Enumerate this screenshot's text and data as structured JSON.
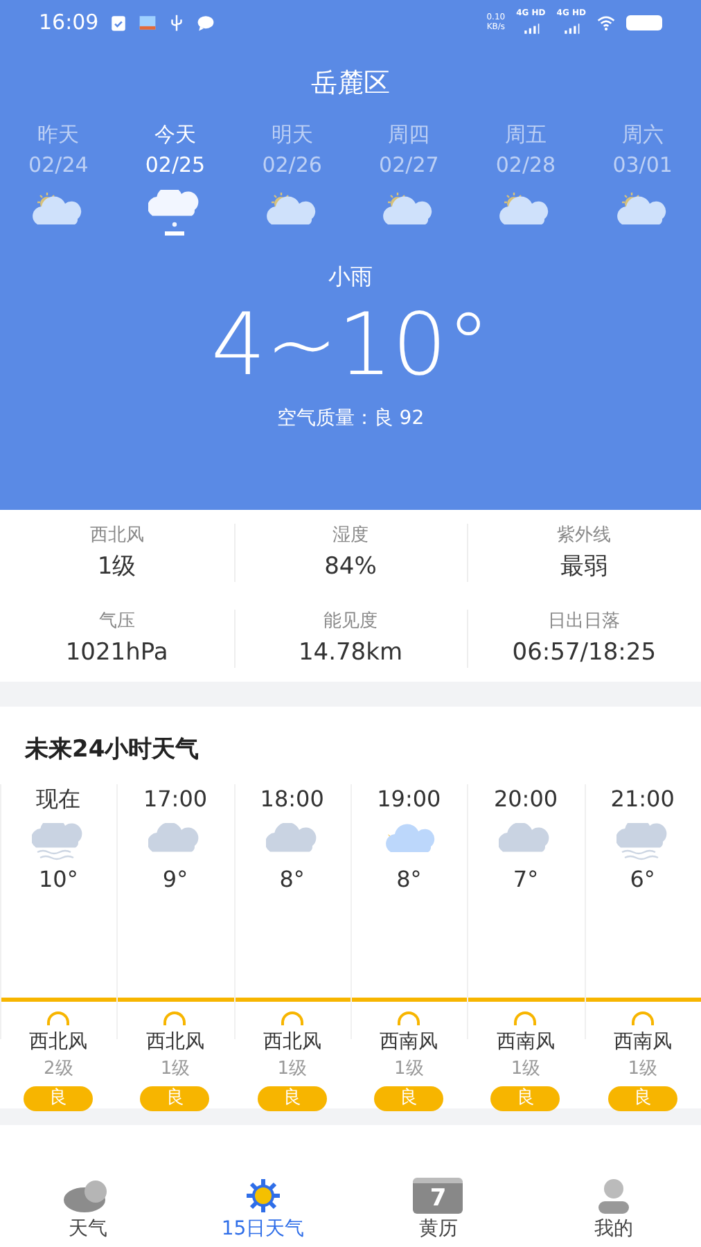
{
  "status_bar": {
    "time": "16:09",
    "net_speed": "0.10",
    "net_unit": "KB/s",
    "signals": [
      "4G HD",
      "4G HD"
    ]
  },
  "header": {
    "location": "岳麓区",
    "condition": "小雨",
    "temperature": "4~10°",
    "air_quality": "空气质量：良 92"
  },
  "days": [
    {
      "label": "昨天",
      "date": "02/24",
      "kind": "sun_cloud",
      "selected": false
    },
    {
      "label": "今天",
      "date": "02/25",
      "kind": "rain",
      "selected": true
    },
    {
      "label": "明天",
      "date": "02/26",
      "kind": "sun_cloud",
      "selected": false
    },
    {
      "label": "周四",
      "date": "02/27",
      "kind": "sun_cloud",
      "selected": false
    },
    {
      "label": "周五",
      "date": "02/28",
      "kind": "sun_cloud",
      "selected": false
    },
    {
      "label": "周六",
      "date": "03/01",
      "kind": "sun_cloud",
      "selected": false
    }
  ],
  "details": [
    {
      "label": "西北风",
      "value": "1级"
    },
    {
      "label": "湿度",
      "value": "84%"
    },
    {
      "label": "紫外线",
      "value": "最弱"
    },
    {
      "label": "气压",
      "value": "1021hPa"
    },
    {
      "label": "能见度",
      "value": "14.78km"
    },
    {
      "label": "日出日落",
      "value": "06:57/18:25"
    }
  ],
  "hourly": {
    "title": "未来24小时天气",
    "hours": [
      {
        "time": "现在",
        "kind": "fog",
        "temp": "10°",
        "wind": "西北风",
        "level": "2级",
        "aqi": "良"
      },
      {
        "time": "17:00",
        "kind": "cloudy",
        "temp": "9°",
        "wind": "西北风",
        "level": "1级",
        "aqi": "良"
      },
      {
        "time": "18:00",
        "kind": "cloudy",
        "temp": "8°",
        "wind": "西北风",
        "level": "1级",
        "aqi": "良"
      },
      {
        "time": "19:00",
        "kind": "moon_cloud",
        "temp": "8°",
        "wind": "西南风",
        "level": "1级",
        "aqi": "良"
      },
      {
        "time": "20:00",
        "kind": "cloudy",
        "temp": "7°",
        "wind": "西南风",
        "level": "1级",
        "aqi": "良"
      },
      {
        "time": "21:00",
        "kind": "fog",
        "temp": "6°",
        "wind": "西南风",
        "level": "1级",
        "aqi": "良"
      }
    ]
  },
  "bottom_nav": [
    {
      "label": "天气",
      "kind": "cloud",
      "selected": false
    },
    {
      "label": "15日天气",
      "kind": "sun",
      "selected": true
    },
    {
      "label": "黄历",
      "kind": "calendar",
      "icon_text": "7",
      "selected": false
    },
    {
      "label": "我的",
      "kind": "person",
      "selected": false
    }
  ]
}
